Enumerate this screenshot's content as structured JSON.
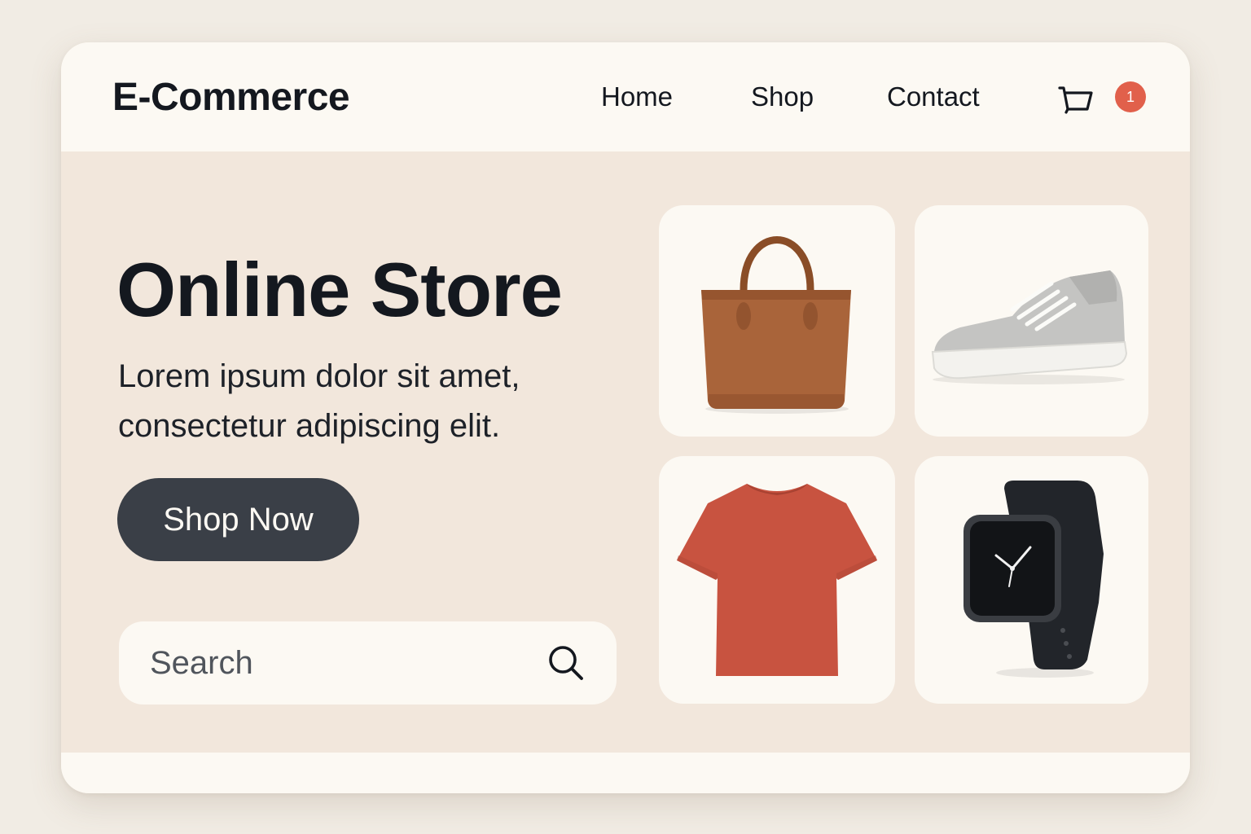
{
  "brand": {
    "logo": "E-Commerce"
  },
  "nav": {
    "items": [
      "Home",
      "Shop",
      "Contact"
    ]
  },
  "cart": {
    "icon": "cart-icon",
    "count": "1",
    "badge_color": "#e1604b"
  },
  "hero": {
    "title": "Online Store",
    "subtitle_line1": "Lorem ipsum dolor sit amet,",
    "subtitle_line2": "consectetur adipiscing elit.",
    "cta_label": "Shop Now"
  },
  "search": {
    "placeholder": "Search",
    "icon": "search-icon"
  },
  "products": [
    {
      "icon": "handbag-icon",
      "color": "#a9643a"
    },
    {
      "icon": "sneaker-icon",
      "color": "#c4c4c2"
    },
    {
      "icon": "tshirt-icon",
      "color": "#c85340"
    },
    {
      "icon": "smartwatch-icon",
      "color": "#22252a"
    }
  ],
  "colors": {
    "page_bg": "#f1ece4",
    "panel_bg": "#f2e7dc",
    "header_bg": "#fcf9f3",
    "button_bg": "#3a3f47",
    "text": "#14181f"
  }
}
